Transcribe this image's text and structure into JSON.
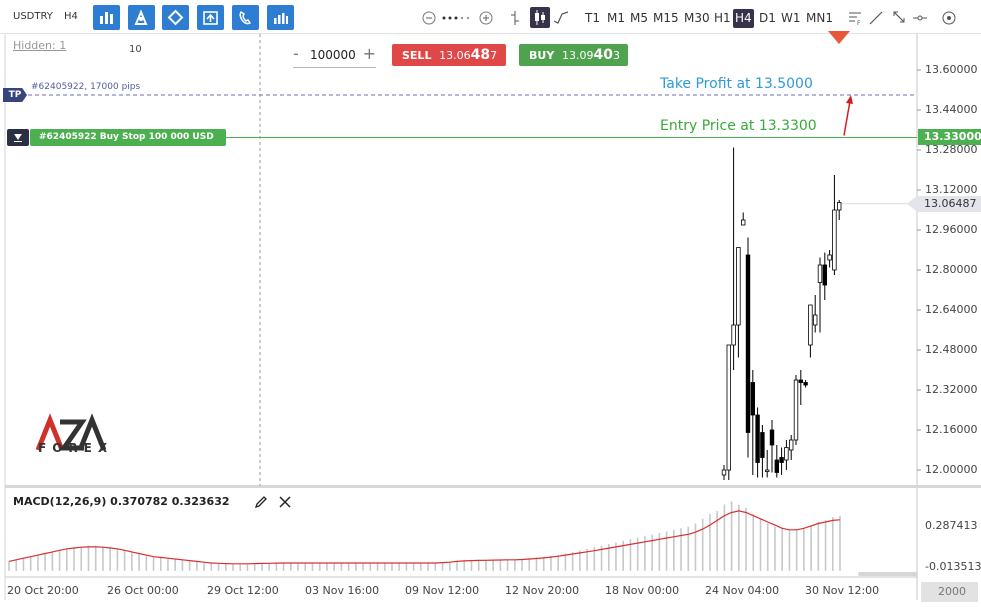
{
  "toolbar": {
    "symbol": "USDTRY",
    "timeframe_small": "H4",
    "buttons": [
      {
        "name": "chart-type-bars-icon"
      },
      {
        "name": "indicators-icon"
      },
      {
        "name": "drawing-tools-icon"
      },
      {
        "name": "trade-icon"
      },
      {
        "name": "alerts-icon"
      },
      {
        "name": "statistics-icon"
      }
    ],
    "timeframes": [
      "T1",
      "M1",
      "M5",
      "M15",
      "M30",
      "H1",
      "H4",
      "D1",
      "W1",
      "MN1"
    ],
    "active_timeframe": "H4"
  },
  "chart": {
    "hidden_label": "Hidden: 1",
    "hidden_count": "10",
    "quantity": {
      "minus": "-",
      "value": "100000",
      "plus": "+"
    },
    "sell": {
      "label": "SELL",
      "price_head": "13.06",
      "price_big": "48",
      "price_tail": "7"
    },
    "buy": {
      "label": "BUY",
      "price_head": "13.09",
      "price_big": "40",
      "price_tail": "3"
    },
    "tp": {
      "tag": "TP",
      "text": "#62405922, 17000 pips",
      "note": "Take Profit at 13.5000"
    },
    "entry": {
      "text": "#62405922 Buy Stop 100 000 USD",
      "note": "Entry Price at 13.3300",
      "price": "13.33000"
    },
    "current_price": "13.06487",
    "price_ticks": [
      "13.60000",
      "13.44000",
      "13.28000",
      "13.12000",
      "12.96000",
      "12.80000",
      "12.64000",
      "12.48000",
      "12.32000",
      "12.16000",
      "12.00000"
    ],
    "macd": {
      "label": "MACD(12,26,9) 0.370782 0.323632",
      "ticks": [
        "0.287413",
        "-0.013513"
      ]
    },
    "x_labels": [
      "20 Oct 20:00",
      "26 Oct 00:00",
      "29 Oct 12:00",
      "03 Nov 16:00",
      "09 Nov 12:00",
      "12 Nov 20:00",
      "18 Nov 00:00",
      "24 Nov 04:00",
      "30 Nov 12:00"
    ],
    "zoom": "2000",
    "logo": {
      "sub": "FOREX"
    }
  },
  "colors": {
    "toolbar_button": "#2d7dd2",
    "sell": "#e04747",
    "buy": "#4fa34f",
    "tp_line": "#6a6fb5",
    "entry_line": "#4caf50",
    "take_profit_text": "#2e9ad6",
    "macd_signal": "#d83030",
    "macd_hist": "#c8c8c8"
  },
  "chart_data": {
    "type": "candlestick",
    "candles": [
      {
        "o": 11.98,
        "h": 12.02,
        "l": 11.96,
        "c": 12.0
      },
      {
        "o": 12.0,
        "h": 12.5,
        "l": 11.96,
        "c": 12.5
      },
      {
        "o": 12.5,
        "h": 13.29,
        "l": 12.4,
        "c": 12.58
      },
      {
        "o": 12.58,
        "h": 12.84,
        "l": 12.45,
        "c": 12.89
      },
      {
        "o": 12.98,
        "h": 13.03,
        "l": 12.98,
        "c": 13.0
      },
      {
        "o": 12.86,
        "h": 12.93,
        "l": 12.05,
        "c": 12.15
      },
      {
        "o": 12.35,
        "h": 12.4,
        "l": 11.98,
        "c": 12.22
      },
      {
        "o": 12.22,
        "h": 12.25,
        "l": 11.97,
        "c": 12.03
      },
      {
        "o": 12.15,
        "h": 12.18,
        "l": 11.97,
        "c": 12.05
      },
      {
        "o": 12.0,
        "h": 12.08,
        "l": 11.97,
        "c": 12.0
      },
      {
        "o": 12.16,
        "h": 12.2,
        "l": 11.99,
        "c": 12.1
      },
      {
        "o": 12.04,
        "h": 12.1,
        "l": 11.97,
        "c": 11.99
      },
      {
        "o": 12.05,
        "h": 12.09,
        "l": 11.98,
        "c": 12.03
      },
      {
        "o": 12.04,
        "h": 12.12,
        "l": 12.0,
        "c": 12.09
      },
      {
        "o": 12.08,
        "h": 12.14,
        "l": 12.04,
        "c": 12.12
      },
      {
        "o": 12.12,
        "h": 12.38,
        "l": 12.1,
        "c": 12.36
      },
      {
        "o": 12.36,
        "h": 12.4,
        "l": 12.26,
        "c": 12.35
      },
      {
        "o": 12.35,
        "h": 12.36,
        "l": 12.33,
        "c": 12.34
      },
      {
        "o": 12.5,
        "h": 12.66,
        "l": 12.45,
        "c": 12.66
      },
      {
        "o": 12.58,
        "h": 12.7,
        "l": 12.55,
        "c": 12.62
      },
      {
        "o": 12.75,
        "h": 12.85,
        "l": 12.55,
        "c": 12.82
      },
      {
        "o": 12.82,
        "h": 12.87,
        "l": 12.68,
        "c": 12.74
      },
      {
        "o": 12.84,
        "h": 12.88,
        "l": 12.81,
        "c": 12.86
      },
      {
        "o": 12.8,
        "h": 13.18,
        "l": 12.78,
        "c": 13.04
      },
      {
        "o": 13.04,
        "h": 13.08,
        "l": 13.0,
        "c": 13.07
      }
    ],
    "macd_hist": [
      0.06,
      0.07,
      0.08,
      0.09,
      0.1,
      0.11,
      0.12,
      0.13,
      0.14,
      0.15,
      0.155,
      0.16,
      0.16,
      0.155,
      0.15,
      0.14,
      0.13,
      0.12,
      0.11,
      0.1,
      0.09,
      0.085,
      0.08,
      0.075,
      0.07,
      0.065,
      0.06,
      0.055,
      0.05,
      0.045,
      0.04,
      0.04,
      0.04,
      0.04,
      0.04,
      0.045,
      0.05,
      0.05,
      0.05,
      0.05,
      0.05,
      0.05,
      0.05,
      0.05,
      0.05,
      0.05,
      0.05,
      0.05,
      0.05,
      0.05,
      0.05,
      0.05,
      0.05,
      0.05,
      0.05,
      0.05,
      0.05,
      0.05,
      0.05,
      0.05,
      0.055,
      0.06,
      0.065,
      0.07,
      0.07,
      0.07,
      0.07,
      0.07,
      0.07,
      0.07,
      0.07,
      0.075,
      0.08,
      0.085,
      0.09,
      0.095,
      0.1,
      0.11,
      0.12,
      0.13,
      0.14,
      0.15,
      0.16,
      0.17,
      0.18,
      0.19,
      0.2,
      0.21,
      0.22,
      0.23,
      0.24,
      0.25,
      0.26,
      0.27,
      0.28,
      0.3,
      0.33,
      0.36,
      0.38,
      0.42,
      0.44,
      0.42,
      0.4,
      0.36,
      0.33,
      0.3,
      0.28,
      0.27,
      0.26,
      0.26,
      0.27,
      0.29,
      0.31,
      0.32,
      0.34,
      0.35
    ],
    "macd_signal": [
      0.06,
      0.07,
      0.08,
      0.09,
      0.1,
      0.11,
      0.12,
      0.13,
      0.14,
      0.145,
      0.15,
      0.152,
      0.152,
      0.15,
      0.145,
      0.14,
      0.13,
      0.12,
      0.11,
      0.1,
      0.09,
      0.085,
      0.08,
      0.075,
      0.07,
      0.065,
      0.06,
      0.055,
      0.05,
      0.048,
      0.046,
      0.045,
      0.045,
      0.045,
      0.046,
      0.047,
      0.048,
      0.049,
      0.05,
      0.05,
      0.05,
      0.05,
      0.05,
      0.05,
      0.05,
      0.05,
      0.05,
      0.05,
      0.05,
      0.05,
      0.05,
      0.05,
      0.05,
      0.05,
      0.05,
      0.05,
      0.05,
      0.05,
      0.05,
      0.05,
      0.052,
      0.055,
      0.06,
      0.063,
      0.065,
      0.066,
      0.067,
      0.068,
      0.069,
      0.07,
      0.07,
      0.072,
      0.075,
      0.078,
      0.082,
      0.087,
      0.093,
      0.1,
      0.107,
      0.114,
      0.121,
      0.128,
      0.136,
      0.144,
      0.152,
      0.16,
      0.168,
      0.176,
      0.184,
      0.192,
      0.2,
      0.208,
      0.216,
      0.224,
      0.232,
      0.245,
      0.265,
      0.29,
      0.32,
      0.35,
      0.37,
      0.38,
      0.37,
      0.35,
      0.33,
      0.31,
      0.29,
      0.27,
      0.26,
      0.26,
      0.27,
      0.285,
      0.3,
      0.31,
      0.32,
      0.324
    ],
    "y_range": [
      11.95,
      13.7
    ],
    "macd_range": [
      -0.02,
      0.5
    ]
  }
}
